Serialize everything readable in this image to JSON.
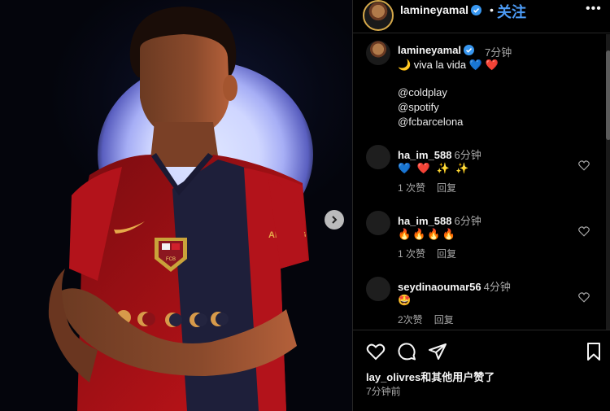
{
  "post": {
    "username": "lamineyamal",
    "dot": "•",
    "follow_label": "关注",
    "more_label": "•••",
    "caption_time": "7分钟",
    "caption_text": "🌙 viva la vida 💙 ❤️",
    "mentions": [
      "@coldplay",
      "@spotify",
      "@fcbarcelona"
    ],
    "shirt_sponsor": "AMBILIG",
    "crest_text": "FCB"
  },
  "comments": [
    {
      "user": "ha_im_588",
      "time": "6分钟",
      "body": "💙 ❤️ ✨ ✨",
      "likes": "1 次赞",
      "reply": "回复"
    },
    {
      "user": "ha_im_588",
      "time": "6分钟",
      "body": "🔥🔥🔥🔥",
      "likes": "1 次赞",
      "reply": "回复"
    },
    {
      "user": "seydinaoumar56",
      "time": "4分钟",
      "body": "🤩",
      "likes": "2次赞",
      "reply": "回复"
    }
  ],
  "footer": {
    "likes_text": "lay_olivres和其他用户赞了",
    "time_ago": "7分钟前"
  },
  "colors": {
    "accent": "#4c9bf5",
    "verified": "#3897f0",
    "muted": "#a8a8a8",
    "border": "#262626"
  }
}
